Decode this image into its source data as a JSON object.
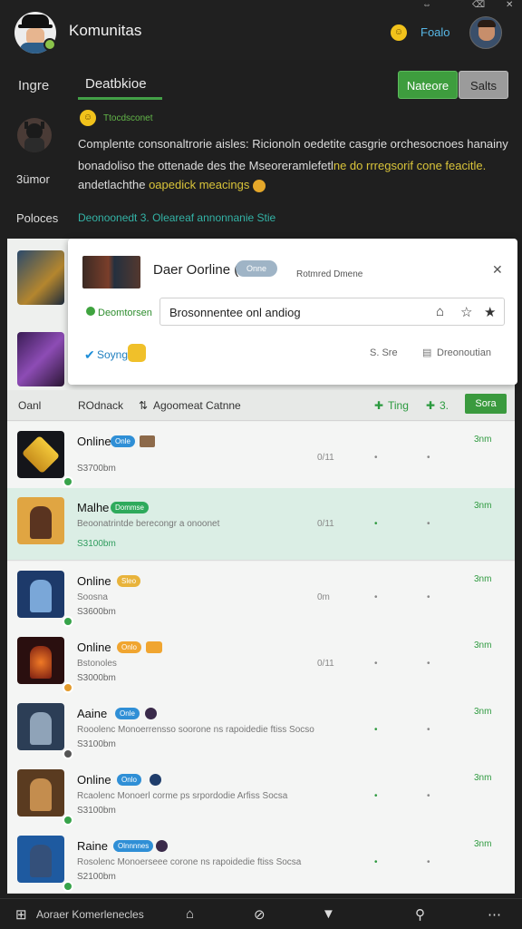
{
  "header": {
    "title": "Komunitas",
    "link": "Foalo",
    "coin_icon": "coin-icon",
    "top_icons": [
      "⇔",
      "⌫",
      "✕"
    ]
  },
  "tabs": {
    "left": "Ingre",
    "active": "Deatbkioe",
    "btn_green": "Nateore",
    "btn_grey": "Salts"
  },
  "post": {
    "side_label_1": "3ümor",
    "side_label_2": "Poloces",
    "small_tag": "Ttocdsconet",
    "line1": "Complente consonaltrorie aisles: Ricionoln oedetite casgrie orchesocnoes hanainy",
    "line2_a": "bonadoliso the ottenade des the Mseoreramlefetl",
    "line2_b": "ne do rrregsorif cone feacitle.",
    "line3_a": "andetlachthe",
    "line3_b": "oapedick meacings",
    "green_line": "Deonoonedt 3.  Oleareaf annonnanie Stie"
  },
  "popup": {
    "title": "Daer Oorline (",
    "chip": "Onne",
    "meta": "Rotmred Dmene",
    "status": "Deomtorsen",
    "input_value": "Brosonnentee onl andiog",
    "link": "Soyng",
    "action_1": "S. Sre",
    "action_2": "Dreonoutian"
  },
  "columns": {
    "c1": "Oanl",
    "c2": "ROdnack",
    "c3": "Agoomeat Catnne",
    "c4": "Ting",
    "c5": "3.",
    "btn": "Sora"
  },
  "rows": [
    {
      "name": "Online",
      "badge": "Onle",
      "desc": "",
      "sub": "S3700bm",
      "num": "0/11",
      "time": "3nm"
    },
    {
      "name": "Malhe",
      "badge": "Dommse",
      "desc": "Beoonatrintde berecongr a onoonet",
      "sub": "S3100bm",
      "num": "0/11",
      "time": "3nm"
    },
    {
      "name": "Online",
      "badge": "Sleo",
      "desc": "Soosna",
      "sub": "S3600bm",
      "num": "0m",
      "time": "3nm"
    },
    {
      "name": "Online",
      "badge": "Onlo",
      "desc": "Bstonoles",
      "sub": "S3000bm",
      "num": "0/11",
      "time": "3nm"
    },
    {
      "name": "Aaine",
      "badge": "Onle",
      "desc": "Rooolenc Monoerrensso soorone ns rapoidedie ftiss  Socso",
      "sub": "S3100bm",
      "num": "",
      "time": "3nm"
    },
    {
      "name": "Online",
      "badge": "Onlo",
      "desc": "Rcaolenc Monoerl corme ps srpordodie Arfiss  Socsa",
      "sub": "S3100bm",
      "num": "",
      "time": "3nm"
    },
    {
      "name": "Raine",
      "badge": "Olnnnnes",
      "desc": "Rosolenc Monoerseee corone ns rapoidedie ftiss  Socsa",
      "sub": "S2100bm",
      "num": "",
      "time": "3nm"
    }
  ],
  "bottom_bar": {
    "label": "Aoraer Komerlenecles"
  },
  "colors": {
    "accent_green": "#43a047",
    "link_blue": "#57b7e6",
    "highlight_row": "#dbeee5"
  }
}
